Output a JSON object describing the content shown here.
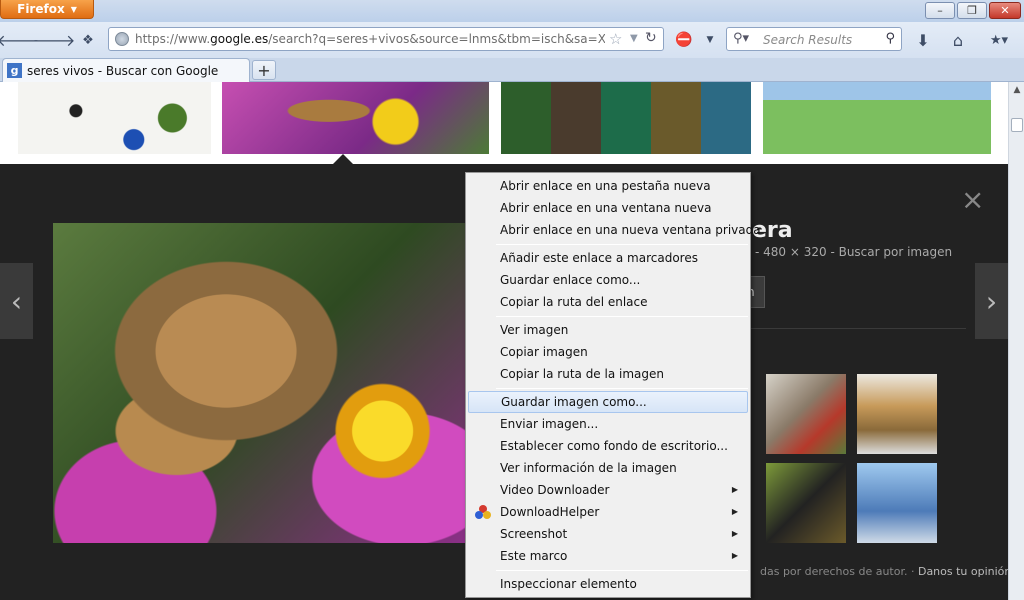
{
  "browser": {
    "menu_button": "Firefox",
    "url_prefix": "https://www.",
    "url_domain": "google.es",
    "url_rest": "/search?q=seres+vivos&source=lnms&tbm=isch&sa=X&ei=CXK",
    "search_placeholder": "Search Results",
    "tab_title": "seres vivos - Buscar con Google",
    "tab_favicon": "g",
    "new_tab": "+",
    "window_buttons": [
      "–",
      "❐",
      "✕"
    ]
  },
  "viewer": {
    "title_fragment": "era",
    "info_fragment": "- 480 × 320 - Buscar por imagen",
    "button_fragment": "n",
    "footer_text": "das por derechos de autor. ·",
    "footer_link": "Danos tu opinión",
    "close": "×",
    "prev": "‹",
    "next": "›"
  },
  "context_menu": {
    "groups": [
      [
        "Abrir enlace en una pestaña nueva",
        "Abrir enlace en una ventana nueva",
        "Abrir enlace en una nueva ventana privada"
      ],
      [
        "Añadir este enlace a marcadores",
        "Guardar enlace como...",
        "Copiar la ruta del enlace"
      ],
      [
        "Ver imagen",
        "Copiar imagen",
        "Copiar la ruta de la imagen"
      ],
      [
        "Guardar imagen como...",
        "Enviar imagen...",
        "Establecer como fondo de escritorio...",
        "Ver información de la imagen",
        "Video Downloader",
        "DownloadHelper",
        "Screenshot",
        "Este marco"
      ],
      [
        "Inspeccionar elemento"
      ]
    ],
    "highlighted": "Guardar imagen como...",
    "submenus": [
      "Video Downloader",
      "DownloadHelper",
      "Screenshot",
      "Este marco"
    ],
    "colors": {
      "highlight_border": "#a8c6ee",
      "menu_bg": "#f0f0f0"
    }
  }
}
